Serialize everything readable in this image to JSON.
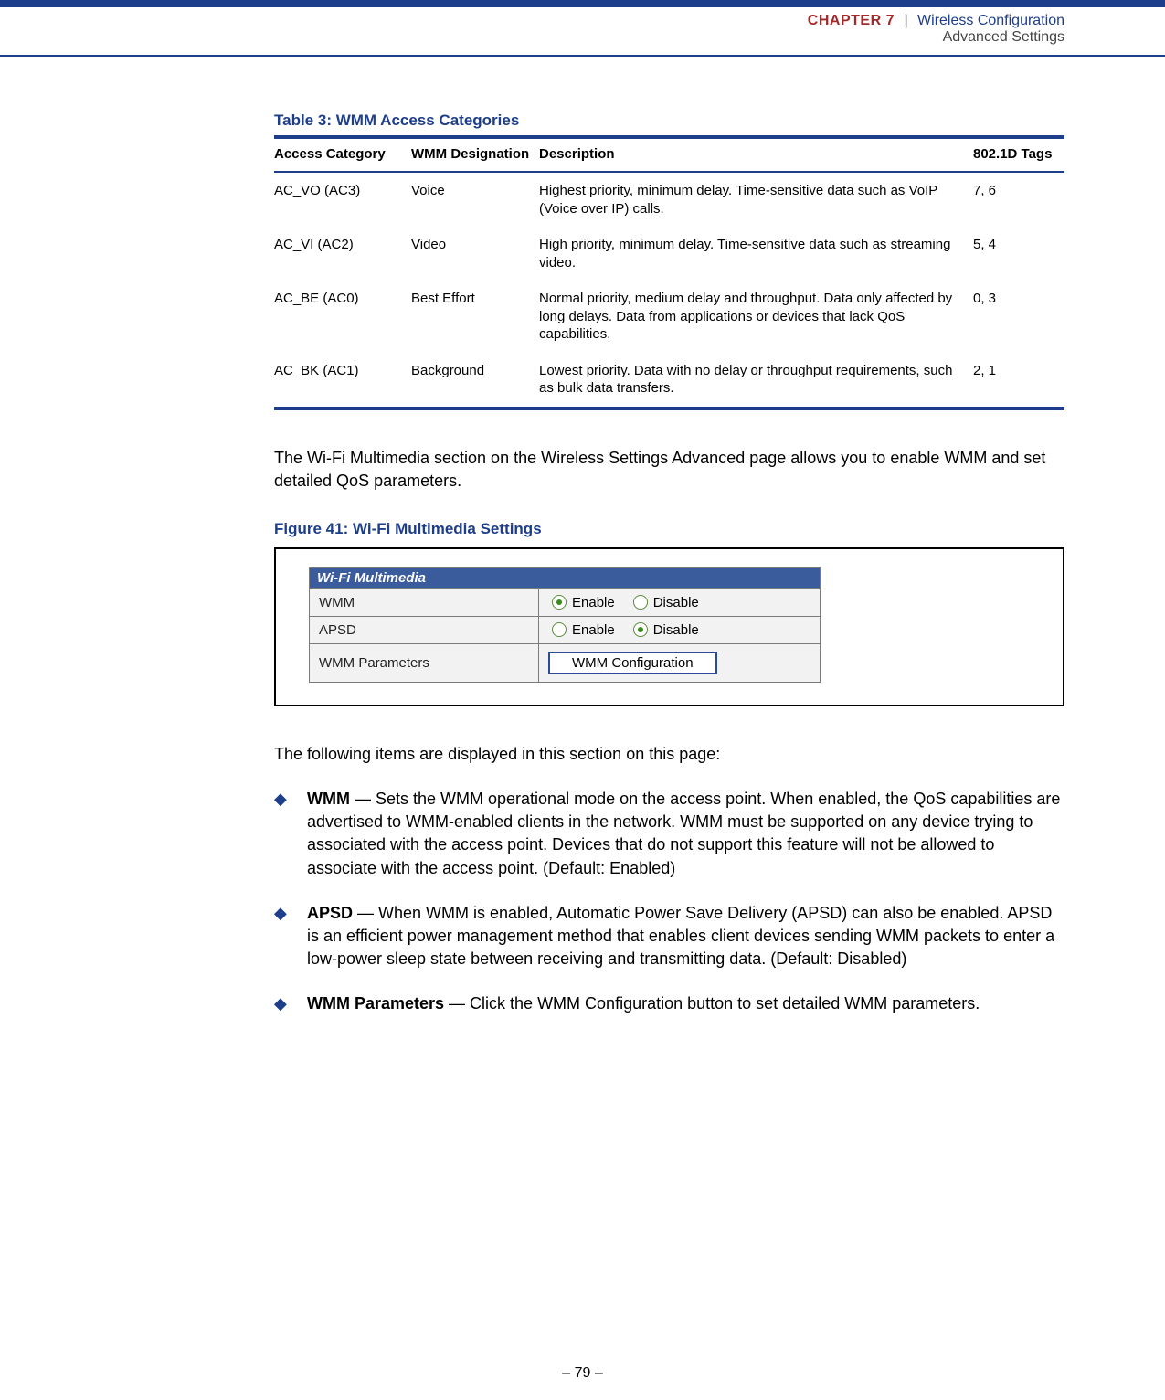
{
  "header": {
    "chapter": "CHAPTER 7",
    "title": "Wireless Configuration",
    "subtitle": "Advanced Settings"
  },
  "table": {
    "caption": "Table 3: WMM Access Categories",
    "headers": {
      "access": "Access Category",
      "wmm": "WMM Designation",
      "desc": "Description",
      "tags": "802.1D Tags"
    },
    "rows": [
      {
        "access": "AC_VO (AC3)",
        "wmm": "Voice",
        "desc": "Highest priority, minimum delay. Time-sensitive data such as VoIP (Voice over IP) calls.",
        "tags": "7, 6"
      },
      {
        "access": "AC_VI (AC2)",
        "wmm": "Video",
        "desc": "High priority, minimum delay. Time-sensitive data such as streaming video.",
        "tags": "5, 4"
      },
      {
        "access": "AC_BE (AC0)",
        "wmm": "Best Effort",
        "desc": "Normal priority, medium delay and throughput. Data only affected by long delays. Data from applications or devices that lack QoS capabilities.",
        "tags": "0, 3"
      },
      {
        "access": "AC_BK (AC1)",
        "wmm": "Background",
        "desc": "Lowest priority. Data with no delay or throughput requirements, such as bulk data transfers.",
        "tags": "2, 1"
      }
    ]
  },
  "para1": "The Wi-Fi Multimedia section on the Wireless Settings Advanced page allows you to enable WMM and set detailed QoS parameters.",
  "figure": {
    "caption": "Figure 41:  Wi-Fi Multimedia Settings",
    "panel_title": "Wi-Fi Multimedia",
    "rows": {
      "wmm": {
        "label": "WMM",
        "enable": "Enable",
        "disable": "Disable"
      },
      "apsd": {
        "label": "APSD",
        "enable": "Enable",
        "disable": "Disable"
      },
      "params": {
        "label": "WMM Parameters",
        "button": "WMM Configuration"
      }
    }
  },
  "para2": "The following items are displayed in this section on this page:",
  "items": {
    "wmm": {
      "label": "WMM",
      "text": " — Sets the WMM operational mode on the access point. When enabled, the QoS capabilities are advertised to WMM-enabled clients in the network. WMM must be supported on any device trying to associated with the access point. Devices that do not support this feature will not be allowed to associate with the access point. (Default: Enabled)"
    },
    "apsd": {
      "label": "APSD",
      "text": " — When WMM is enabled, Automatic Power Save Delivery (APSD) can also be enabled. APSD is an efficient power management method that enables client devices sending WMM packets to enter a low-power sleep state between receiving and transmitting data. (Default: Disabled)"
    },
    "params": {
      "label": "WMM Parameters",
      "text": " — Click the WMM Configuration button to set detailed WMM parameters."
    }
  },
  "footer": "–  79  –"
}
